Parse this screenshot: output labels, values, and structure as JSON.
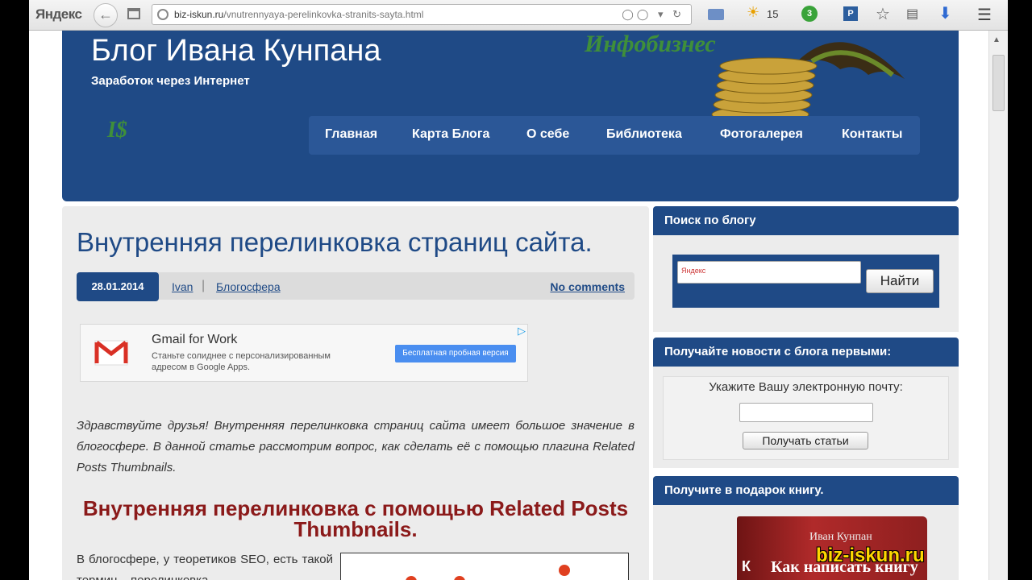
{
  "browser": {
    "brand": "Яндекс",
    "url_host": "biz-iskun.ru",
    "url_path": "/vnutrennyaya-perelinkovka-stranits-sayta.html",
    "weather_temp": "15",
    "badge_count": "3"
  },
  "header": {
    "site_title": "Блог Ивана Кунпана",
    "tagline": "Заработок через Интернет",
    "logo_mark": "I$",
    "infobiz_label": "Инфобизнес",
    "nav": [
      {
        "label": "Главная"
      },
      {
        "label": "Карта Блога"
      },
      {
        "label": "О себе"
      },
      {
        "label": "Библиотека"
      },
      {
        "label": "Фотогалерея"
      },
      {
        "label": "Контакты"
      }
    ]
  },
  "post": {
    "title": "Внутренняя перелинковка страниц сайта.",
    "date": "28.01.2014",
    "author": "Ivan",
    "category": "Блогосфера",
    "comments": "No comments",
    "ad": {
      "title": "Gmail for Work",
      "desc_line1": "Станьте солиднее с персонализированным",
      "desc_line2": "адресом в Google Apps.",
      "button": "Бесплатная пробная версия"
    },
    "intro": "Здравствуйте друзья! Внутренняя перелинковка страниц сайта имеет большое значение в блогосфере. В данной статье рассмотрим вопрос, как сделать её с помощью плагина Related Posts Thumbnails.",
    "subheading": "Внутренняя перелинковка с помощью Related Posts Thumbnails.",
    "body": "В блогосфере, у теоретиков SEO, есть такой термин – перелинковка"
  },
  "sidebar": {
    "search": {
      "heading": "Поиск по блогу",
      "placeholder": "Яндекс",
      "button": "Найти"
    },
    "subscribe": {
      "heading": "Получайте новости с блога первыми:",
      "label": "Укажите Вашу электронную почту:",
      "button": "Получать статьи"
    },
    "book": {
      "heading": "Получите в подарок книгу.",
      "author": "Иван Кунпан",
      "title": "Как написать книгу",
      "spine": "К"
    }
  },
  "watermark": "biz-iskun.ru"
}
